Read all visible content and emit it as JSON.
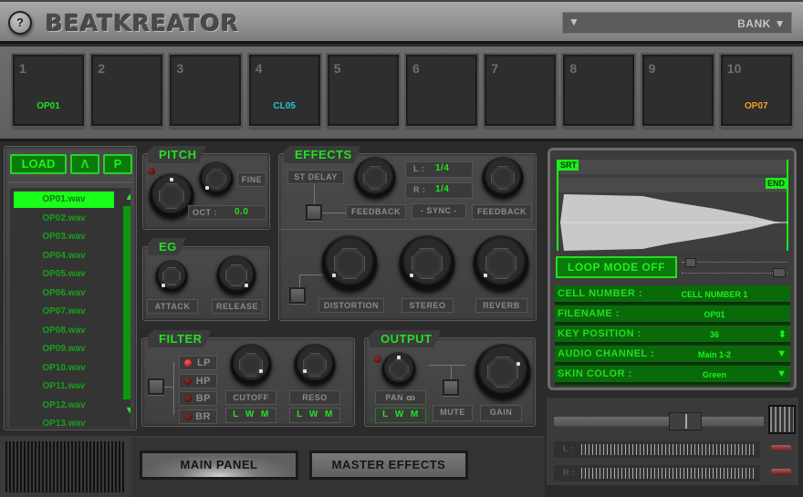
{
  "header": {
    "help_label": "?",
    "title": "BEATKREATOR",
    "bank_select": {
      "left_arrow": "▼",
      "label": "BANK ▼"
    }
  },
  "pads": [
    {
      "number": "1",
      "sample": "OP01",
      "color": "#22e022"
    },
    {
      "number": "2",
      "sample": "",
      "color": ""
    },
    {
      "number": "3",
      "sample": "",
      "color": ""
    },
    {
      "number": "4",
      "sample": "CL05",
      "color": "#22c8d8"
    },
    {
      "number": "5",
      "sample": "",
      "color": ""
    },
    {
      "number": "6",
      "sample": "",
      "color": ""
    },
    {
      "number": "7",
      "sample": "",
      "color": ""
    },
    {
      "number": "8",
      "sample": "",
      "color": ""
    },
    {
      "number": "9",
      "sample": "",
      "color": ""
    },
    {
      "number": "10",
      "sample": "OP07",
      "color": "#f0a020"
    }
  ],
  "file_panel": {
    "load_label": "LOAD",
    "up_label": "Λ",
    "p_label": "P",
    "scroll_up": "▲",
    "scroll_down": "▼",
    "files": [
      "OP01.wav",
      "OP02.wav",
      "OP03.wav",
      "OP04.wav",
      "OP05.wav",
      "OP06.wav",
      "OP07.wav",
      "OP08.wav",
      "OP09.wav",
      "OP10.wav",
      "OP11.wav",
      "OP12.wav",
      "OP13.wav"
    ],
    "selected_index": 0
  },
  "pitch": {
    "title": "PITCH",
    "fine_label": "FINE",
    "oct_label": "OCT :",
    "oct_value": "0.0"
  },
  "eg": {
    "title": "EG",
    "attack_label": "ATTACK",
    "release_label": "RELEASE"
  },
  "effects": {
    "title": "EFFECTS",
    "st_delay_label": "ST DELAY",
    "l_label": "L :",
    "l_value": "1/4",
    "r_label": "R :",
    "r_value": "1/4",
    "feedback_left_label": "FEEDBACK",
    "sync_label": "- SYNC -",
    "feedback_right_label": "FEEDBACK",
    "distortion_label": "DISTORTION",
    "stereo_label": "STEREO",
    "reverb_label": "REVERB"
  },
  "filter": {
    "title": "FILTER",
    "types": [
      {
        "label": "LP",
        "active": true
      },
      {
        "label": "HP",
        "active": false
      },
      {
        "label": "BP",
        "active": false
      },
      {
        "label": "BR",
        "active": false
      }
    ],
    "cutoff_label": "CUTOFF",
    "reso_label": "RESO",
    "lwm": [
      "L",
      "W",
      "M"
    ]
  },
  "output": {
    "title": "OUTPUT",
    "pan_label": "PAN ꝏ",
    "mute_label": "MUTE",
    "gain_label": "GAIN",
    "lwm": [
      "L",
      "W",
      "M"
    ]
  },
  "waveform": {
    "start_marker": "SRT",
    "end_marker": "END",
    "loop_mode_label": "LOOP MODE OFF"
  },
  "cell_info": [
    {
      "key": "CELL NUMBER :",
      "value": "CELL NUMBER 1",
      "control": ""
    },
    {
      "key": "FILENAME :",
      "value": "OP01",
      "control": ""
    },
    {
      "key": "KEY POSITION :",
      "value": "36",
      "control": "⬍"
    },
    {
      "key": "AUDIO CHANNEL :",
      "value": "Main 1-2",
      "control": "▼"
    },
    {
      "key": "SKIN COLOR :",
      "value": "Green",
      "control": "▼"
    }
  ],
  "mixer": {
    "crossfader_position": 0.65,
    "l_label": "L :",
    "r_label": "R :"
  },
  "bottom_nav": {
    "main_panel_label": "MAIN PANEL",
    "master_effects_label": "MASTER EFFECTS",
    "active": "main_panel"
  },
  "colors": {
    "accent_green": "#22e022",
    "pad_cyan": "#22c8d8",
    "pad_orange": "#f0a020"
  }
}
